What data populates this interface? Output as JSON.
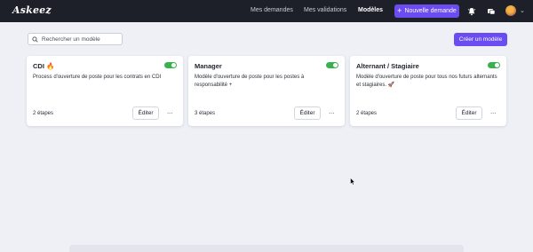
{
  "app": {
    "logo": "Askeez"
  },
  "nav": {
    "links": [
      "Mes demandes",
      "Mes validations",
      "Modèles"
    ],
    "active": "Modèles",
    "new_request_label": "Nouvelle demande",
    "new_request_icon": "plus-icon"
  },
  "toolbar": {
    "search_placeholder": "Rechercher un modèle",
    "create_label": "Créer un modèle"
  },
  "cards": [
    {
      "title": "CDI 🔥",
      "description": "Process d'ouverture de poste pour les contrats en CDI",
      "steps": "2 étapes",
      "enabled": true,
      "edit_label": "Éditer",
      "more_label": "···"
    },
    {
      "title": "Manager",
      "description": "Modèle d'ouverture de poste pour les postes à responsabilité +",
      "steps": "3 étapes",
      "enabled": true,
      "edit_label": "Éditer",
      "more_label": "···"
    },
    {
      "title": "Alternant / Stagiaire",
      "description": "Modèle d'ouverture de poste pour tous nos futurs alternants et stagiaires. 🚀",
      "steps": "2 étapes",
      "enabled": true,
      "edit_label": "Éditer",
      "more_label": "···"
    }
  ],
  "colors": {
    "accent": "#6b4cf0",
    "topbar": "#1d2029",
    "toggle_on": "#37b24d",
    "background": "#eef0f6"
  }
}
